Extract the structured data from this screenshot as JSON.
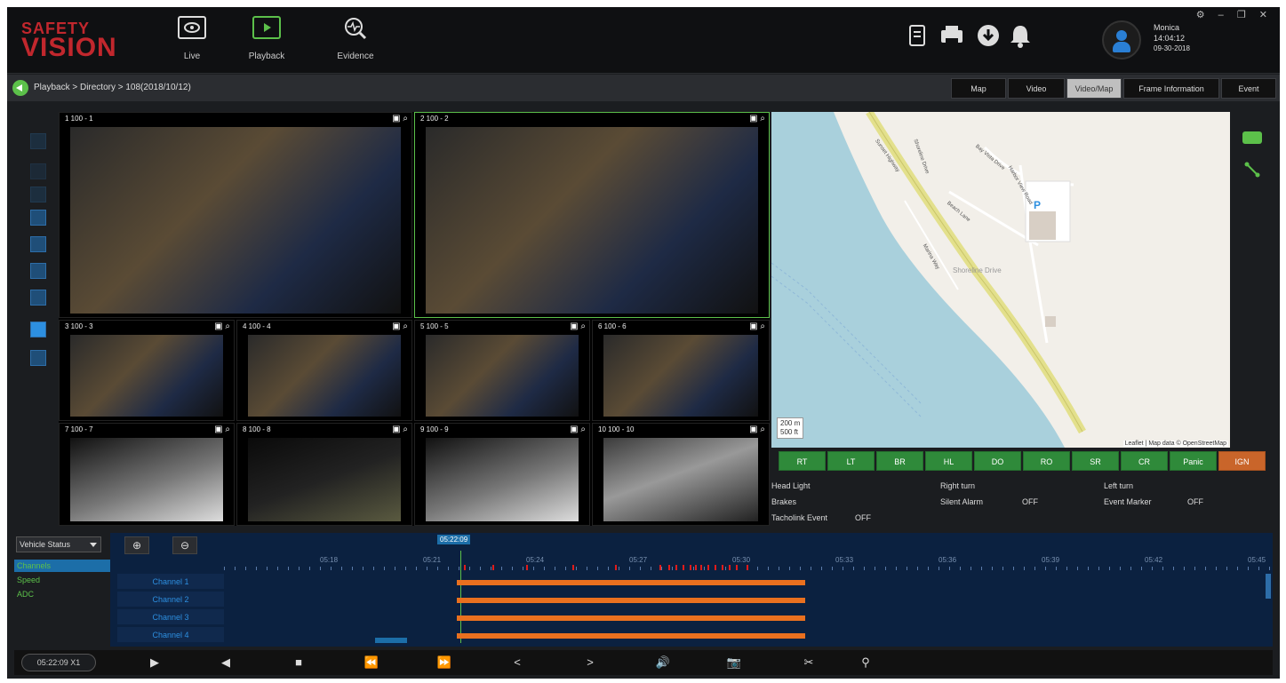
{
  "app": {
    "logo_line1": "SAFETY",
    "logo_line2": "VISION",
    "win_controls": "⚙ – ❐ ✕"
  },
  "nav": [
    {
      "label": "Live",
      "icon": "eye-icon"
    },
    {
      "label": "Playback",
      "icon": "playback-icon"
    },
    {
      "label": "Evidence",
      "icon": "evidence-icon"
    }
  ],
  "toolbar_icons": [
    "report-icon",
    "printer-icon",
    "download-icon",
    "bell-icon"
  ],
  "user": {
    "name": "Monica",
    "time": "14:04:12",
    "date": "09-30-2018"
  },
  "breadcrumb": "Playback > Directory > 108(2018/10/12)",
  "view_tabs": [
    "Map",
    "Video",
    "Video/Map",
    "Frame Information",
    "Event"
  ],
  "active_tab": "Video/Map",
  "cameras": [
    {
      "label": "1 100 - 1",
      "style": "day"
    },
    {
      "label": "2 100 - 2",
      "style": "day",
      "selected": true
    },
    {
      "label": "3 100 - 3",
      "style": "day"
    },
    {
      "label": "4 100 - 4",
      "style": "day"
    },
    {
      "label": "5 100 - 5",
      "style": "day"
    },
    {
      "label": "6 100 - 6",
      "style": "day"
    },
    {
      "label": "7 100 - 7",
      "style": "bw"
    },
    {
      "label": "8 100 - 8",
      "style": "night"
    },
    {
      "label": "9 100 - 9",
      "style": "bw"
    },
    {
      "label": "10 100 - 10",
      "style": "gray"
    }
  ],
  "map": {
    "scale_m": "200 m",
    "scale_ft": "500 ft",
    "attribution": "Leaflet | Map data © OpenStreetMap",
    "parking": "P",
    "place": "Shoreline Drive",
    "road1": "Sunset Highway",
    "road2": "Shoreline Drive",
    "road3": "Bay Vista Drive",
    "road4": "Harbor View Road",
    "road5": "Beach Lane",
    "road6": "Marina Way"
  },
  "status_buttons": [
    {
      "label": "RT",
      "on": true
    },
    {
      "label": "LT",
      "on": true
    },
    {
      "label": "BR",
      "on": true
    },
    {
      "label": "HL",
      "on": true
    },
    {
      "label": "DO",
      "on": true
    },
    {
      "label": "RO",
      "on": true
    },
    {
      "label": "SR",
      "on": true
    },
    {
      "label": "CR",
      "on": true
    },
    {
      "label": "Panic",
      "on": true
    },
    {
      "label": "IGN",
      "on": false
    }
  ],
  "status_labels": {
    "head_light": "Head Light",
    "right_turn": "Right turn",
    "left_turn": "Left turn",
    "brakes": "Brakes",
    "silent_alarm": "Silent Alarm",
    "silent_alarm_val": "OFF",
    "event_marker": "Event Marker",
    "event_marker_val": "OFF",
    "tacholink": "Tacholink Event",
    "tacholink_val": "OFF"
  },
  "timeline": {
    "vehicle_select": "Vehicle Status",
    "left_items": [
      "Channels",
      "Speed",
      "ADC"
    ],
    "cursor_time": "05:22:09",
    "ticks": [
      "05:18",
      "05:21",
      "05:24",
      "05:27",
      "05:30",
      "05:33",
      "05:36",
      "05:39",
      "05:42",
      "05:45"
    ],
    "channels": [
      "Channel 1",
      "Channel 2",
      "Channel 3",
      "Channel 4"
    ]
  },
  "controls": {
    "time_readout": "05:22:09  X1"
  },
  "colors": {
    "accent_green": "#5cc04a",
    "accent_blue": "#2d8fe0",
    "orange": "#e9701f",
    "event_red": "#e01b1b"
  }
}
